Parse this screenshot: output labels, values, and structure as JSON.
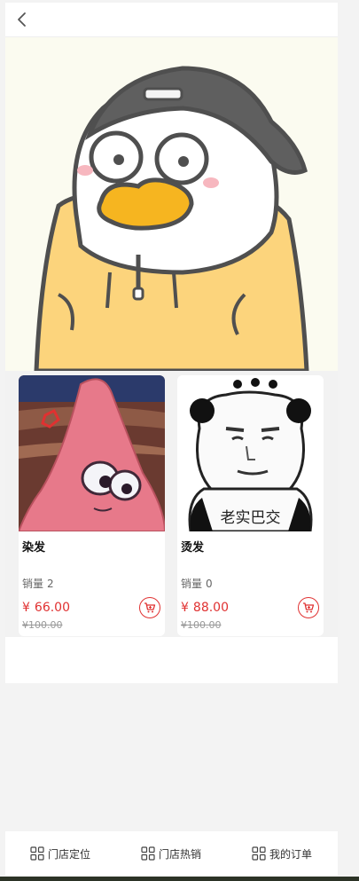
{
  "products": [
    {
      "name": "染发",
      "sales_label": "销量",
      "sales": "2",
      "currency": "¥",
      "price": "66.00",
      "original_price": "¥100.00"
    },
    {
      "name": "烫发",
      "sales_label": "销量",
      "sales": "0",
      "currency": "¥",
      "price": "88.00",
      "original_price": "¥100.00",
      "image_caption": "老实巴交"
    }
  ],
  "tabbar": {
    "items": [
      {
        "label": "门店定位",
        "icon": "grid-icon"
      },
      {
        "label": "门店热销",
        "icon": "grid-icon"
      },
      {
        "label": "我的订单",
        "icon": "grid-icon"
      }
    ]
  },
  "colors": {
    "price": "#e03131",
    "accent": "#e03131",
    "hero_bg": "#fbfbf0"
  }
}
